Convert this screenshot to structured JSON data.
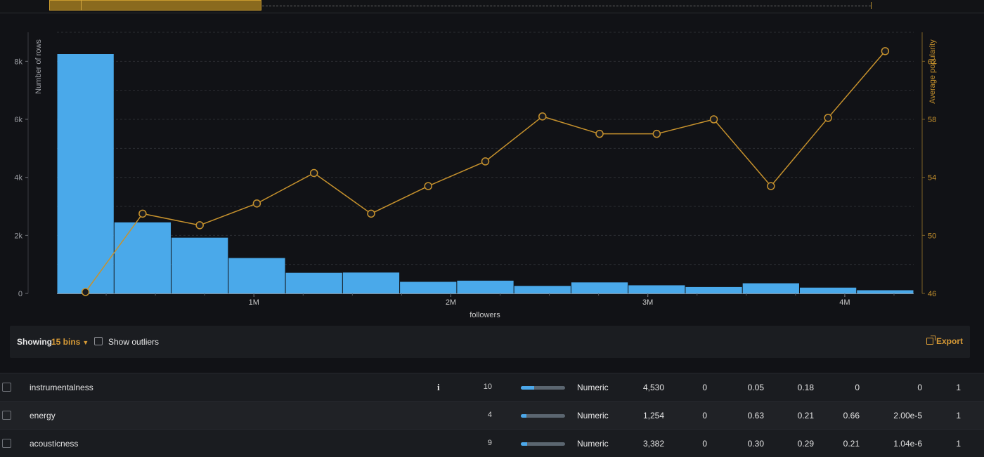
{
  "controls": {
    "showing_label": "Showing",
    "bins_label": "15 bins",
    "outliers_label": "Show outliers",
    "export_label": "Export"
  },
  "chart_data": {
    "type": "bar+line",
    "xlabel": "followers",
    "ylabel_left": "Number of rows",
    "ylabel_right": "Average popularity",
    "x_tick_labels": [
      "1M",
      "2M",
      "3M",
      "4M"
    ],
    "x_ticks": [
      1000000,
      2000000,
      3000000,
      4000000
    ],
    "xlim": [
      0,
      4350000
    ],
    "ylim_left": [
      0,
      9000
    ],
    "y_left_ticks": [
      0,
      2000,
      4000,
      6000,
      8000
    ],
    "y_left_tick_labels": [
      "0",
      "2k",
      "4k",
      "6k",
      "8k"
    ],
    "ylim_right": [
      46,
      64
    ],
    "y_right_ticks": [
      46,
      50,
      54,
      58,
      62
    ],
    "grid": true,
    "bin_width": 290000,
    "bins": [
      {
        "x0": 0,
        "x1": 290000,
        "count": 8250,
        "avg": 46.1
      },
      {
        "x0": 290000,
        "x1": 580000,
        "count": 2450,
        "avg": 51.5
      },
      {
        "x0": 580000,
        "x1": 870000,
        "count": 1920,
        "avg": 50.7
      },
      {
        "x0": 870000,
        "x1": 1160000,
        "count": 1220,
        "avg": 52.2
      },
      {
        "x0": 1160000,
        "x1": 1450000,
        "count": 710,
        "avg": 54.3
      },
      {
        "x0": 1450000,
        "x1": 1740000,
        "count": 720,
        "avg": 51.5
      },
      {
        "x0": 1740000,
        "x1": 2030000,
        "count": 400,
        "avg": 53.4
      },
      {
        "x0": 2030000,
        "x1": 2320000,
        "count": 440,
        "avg": 55.1
      },
      {
        "x0": 2320000,
        "x1": 2610000,
        "count": 260,
        "avg": 58.2
      },
      {
        "x0": 2610000,
        "x1": 2900000,
        "count": 380,
        "avg": 57.0
      },
      {
        "x0": 2900000,
        "x1": 3190000,
        "count": 280,
        "avg": 57.0
      },
      {
        "x0": 3190000,
        "x1": 3480000,
        "count": 220,
        "avg": 58.0
      },
      {
        "x0": 3480000,
        "x1": 3770000,
        "count": 350,
        "avg": 53.4
      },
      {
        "x0": 3770000,
        "x1": 4060000,
        "count": 200,
        "avg": 58.1
      },
      {
        "x0": 4060000,
        "x1": 4350000,
        "count": 110,
        "avg": 62.7
      }
    ],
    "bar_color": "#4aa9ea",
    "line_color": "#c7922d"
  },
  "rows": [
    {
      "name": "instrumentalness",
      "info": "i",
      "count": "10",
      "fill": 0.3,
      "type": "Numeric",
      "c1": "4,530",
      "c2": "0",
      "c3": "0.05",
      "c4": "0.18",
      "c5": "0",
      "c6": "0",
      "c7": "1"
    },
    {
      "name": "energy",
      "info": "",
      "count": "4",
      "fill": 0.12,
      "type": "Numeric",
      "c1": "1,254",
      "c2": "0",
      "c3": "0.63",
      "c4": "0.21",
      "c5": "0.66",
      "c6": "2.00e-5",
      "c7": "1"
    },
    {
      "name": "acousticness",
      "info": "",
      "count": "9",
      "fill": 0.15,
      "type": "Numeric",
      "c1": "3,382",
      "c2": "0",
      "c3": "0.30",
      "c4": "0.29",
      "c5": "0.21",
      "c6": "1.04e-6",
      "c7": "1"
    }
  ]
}
